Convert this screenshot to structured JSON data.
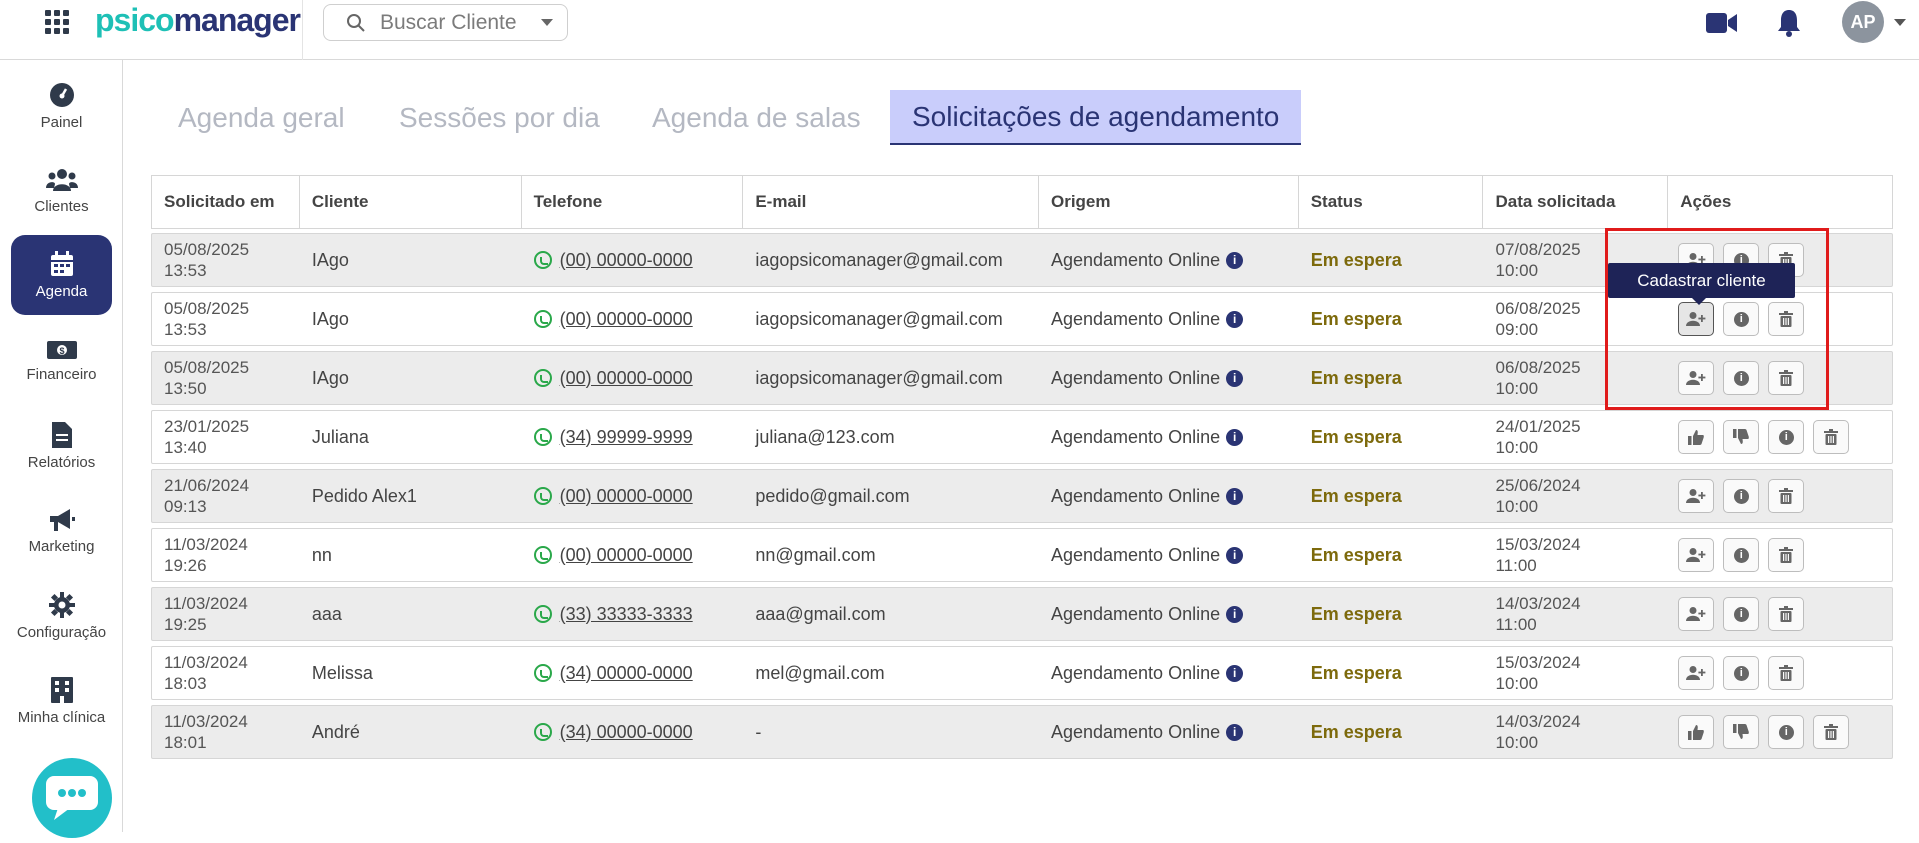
{
  "header": {
    "logo_part1": "psico",
    "logo_part2": "manager",
    "search_placeholder": "Buscar Cliente",
    "avatar_initials": "AP"
  },
  "sidebar": {
    "items": [
      {
        "label": "Painel",
        "icon": "dashboard-icon"
      },
      {
        "label": "Clientes",
        "icon": "users-icon"
      },
      {
        "label": "Agenda",
        "icon": "calendar-icon"
      },
      {
        "label": "Financeiro",
        "icon": "money-icon"
      },
      {
        "label": "Relatórios",
        "icon": "document-icon"
      },
      {
        "label": "Marketing",
        "icon": "megaphone-icon"
      },
      {
        "label": "Configuração",
        "icon": "gear-icon"
      },
      {
        "label": "Minha clínica",
        "icon": "building-icon"
      }
    ],
    "active": "Agenda"
  },
  "tabs": [
    {
      "label": "Agenda geral"
    },
    {
      "label": "Sessões por dia"
    },
    {
      "label": "Agenda de salas"
    },
    {
      "label": "Solicitações de agendamento"
    }
  ],
  "table": {
    "headers": [
      "Solicitado em",
      "Cliente",
      "Telefone",
      "E-mail",
      "Origem",
      "Status",
      "Data solicitada",
      "Ações"
    ],
    "rows": [
      {
        "req_date": "05/08/2025",
        "req_time": "13:53",
        "client": "IAgo",
        "phone": "(00) 00000-0000",
        "email": "iagopsicomanager@gmail.com",
        "origin": "Agendamento Online",
        "status": "Em espera",
        "sched_date": "07/08/2025",
        "sched_time": "10:00"
      },
      {
        "req_date": "05/08/2025",
        "req_time": "13:53",
        "client": "IAgo",
        "phone": "(00) 00000-0000",
        "email": "iagopsicomanager@gmail.com",
        "origin": "Agendamento Online",
        "status": "Em espera",
        "sched_date": "06/08/2025",
        "sched_time": "09:00"
      },
      {
        "req_date": "05/08/2025",
        "req_time": "13:50",
        "client": "IAgo",
        "phone": "(00) 00000-0000",
        "email": "iagopsicomanager@gmail.com",
        "origin": "Agendamento Online",
        "status": "Em espera",
        "sched_date": "06/08/2025",
        "sched_time": "10:00"
      },
      {
        "req_date": "23/01/2025",
        "req_time": "13:40",
        "client": "Juliana",
        "phone": "(34) 99999-9999",
        "email": "juliana@123.com",
        "origin": "Agendamento Online",
        "status": "Em espera",
        "sched_date": "24/01/2025",
        "sched_time": "10:00"
      },
      {
        "req_date": "21/06/2024",
        "req_time": "09:13",
        "client": "Pedido Alex1",
        "phone": "(00) 00000-0000",
        "email": "pedido@gmail.com",
        "origin": "Agendamento Online",
        "status": "Em espera",
        "sched_date": "25/06/2024",
        "sched_time": "10:00"
      },
      {
        "req_date": "11/03/2024",
        "req_time": "19:26",
        "client": "nn",
        "phone": "(00) 00000-0000",
        "email": "nn@gmail.com",
        "origin": "Agendamento Online",
        "status": "Em espera",
        "sched_date": "15/03/2024",
        "sched_time": "11:00"
      },
      {
        "req_date": "11/03/2024",
        "req_time": "19:25",
        "client": "aaa",
        "phone": "(33) 33333-3333",
        "email": "aaa@gmail.com",
        "origin": "Agendamento Online",
        "status": "Em espera",
        "sched_date": "14/03/2024",
        "sched_time": "11:00"
      },
      {
        "req_date": "11/03/2024",
        "req_time": "18:03",
        "client": "Melissa",
        "phone": "(34) 00000-0000",
        "email": "mel@gmail.com",
        "origin": "Agendamento Online",
        "status": "Em espera",
        "sched_date": "15/03/2024",
        "sched_time": "10:00"
      },
      {
        "req_date": "11/03/2024",
        "req_time": "18:01",
        "client": "André",
        "phone": "(34) 00000-0000",
        "email": "-",
        "origin": "Agendamento Online",
        "status": "Em espera",
        "sched_date": "14/03/2024",
        "sched_time": "10:00"
      }
    ]
  },
  "tooltip": {
    "text": "Cadastrar cliente"
  },
  "colors": {
    "brand_dark": "#2a3474",
    "brand_teal": "#1ec0b6",
    "status": "#7d6a0c",
    "highlight": "#e01b1b"
  }
}
